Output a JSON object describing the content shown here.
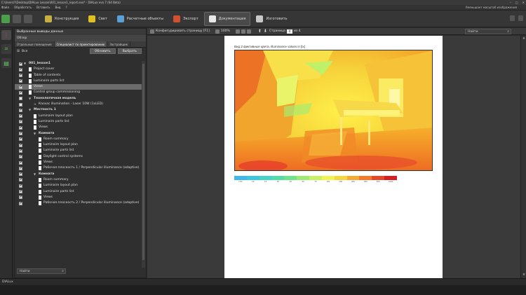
{
  "window": {
    "title": "C:\\Users\\?\\Desktop\\DIALux Lesson\\001_lesson1_report.evo* - DIALux evo 7 (64 Beta)",
    "menu": [
      "Файл",
      "Обработать",
      "Вставить",
      "Вид",
      "?"
    ],
    "menu_hint": "Уменьшает масштаб изображения"
  },
  "toolbar": {
    "tabs": [
      {
        "label": "Конструкция",
        "color": "#c8b040"
      },
      {
        "label": "Свет",
        "color": "#e0c020"
      },
      {
        "label": "Расчетные объекты",
        "color": "#5aa0d8"
      },
      {
        "label": "Экспорт",
        "color": "#d05030"
      },
      {
        "label": "Документация",
        "color": "#e8e8e8"
      },
      {
        "label": "Изготовить",
        "color": "#c8c8c8"
      }
    ],
    "active_tab": "Документация"
  },
  "left_panel": {
    "header": "Выбранные выводы данных",
    "sub": "Обзор",
    "tabs": [
      "Отдельные помещения",
      "Специалист по проектированию",
      "Застройщик"
    ],
    "active_tab": "Специалист по проектированию",
    "all_label": "Все",
    "button_refresh": "Обновить",
    "button_select": "Выбрать",
    "search_value": "Найти",
    "tree": [
      {
        "label": "001_lesson1",
        "level": 0,
        "bold": true,
        "expand": true,
        "checked": true
      },
      {
        "label": "Project cover",
        "level": 1,
        "checked": true
      },
      {
        "label": "Table of contents",
        "level": 1,
        "checked": true
      },
      {
        "label": "Luminaire parts list",
        "level": 1,
        "checked": true
      },
      {
        "label": "Views",
        "level": 1,
        "checked": true,
        "selected": true
      },
      {
        "label": "Control group commissioning",
        "level": 1,
        "checked": true
      },
      {
        "label": "Технологичная модель",
        "level": 1,
        "bold": true,
        "expand": true,
        "checked": false
      },
      {
        "label": "Каскас illumination - Laser 10W (1xLED)",
        "level": 2,
        "checked": false,
        "arrow": true
      },
      {
        "label": "Местность 1",
        "level": 1,
        "bold": true,
        "expand": true,
        "checked": true
      },
      {
        "label": "Luminaire layout plan",
        "level": 2,
        "checked": true
      },
      {
        "label": "Luminaire parts list",
        "level": 2,
        "checked": true
      },
      {
        "label": "Views",
        "level": 2,
        "checked": true
      },
      {
        "label": "Комната",
        "level": 2,
        "bold": true,
        "expand": true,
        "checked": true
      },
      {
        "label": "Room summary",
        "level": 3,
        "checked": true
      },
      {
        "label": "Luminaire layout plan",
        "level": 3,
        "checked": true
      },
      {
        "label": "Luminaire parts list",
        "level": 3,
        "checked": true
      },
      {
        "label": "Daylight control systems",
        "level": 3,
        "checked": true
      },
      {
        "label": "Views",
        "level": 3,
        "checked": true
      },
      {
        "label": "Рабочая плоскость 1 / Perpendicular illuminance (adaptive)",
        "level": 3,
        "checked": true
      },
      {
        "label": "Комната",
        "level": 2,
        "bold": true,
        "expand": true,
        "checked": true
      },
      {
        "label": "Room summary",
        "level": 3,
        "checked": true
      },
      {
        "label": "Luminaire layout plan",
        "level": 3,
        "checked": true
      },
      {
        "label": "Luminaire parts list",
        "level": 3,
        "checked": true
      },
      {
        "label": "Views",
        "level": 3,
        "checked": true
      },
      {
        "label": "Рабочая плоскость 2 / Perpendicular illuminance (adaptive)",
        "level": 3,
        "checked": true
      }
    ]
  },
  "doc_toolbar": {
    "configure": "Конфигурировать страницу [F1]",
    "zoom": "100%",
    "page_label": "Страница",
    "page_current": "4",
    "page_total": "из 4",
    "search": "Найти"
  },
  "page": {
    "caption": "Вид 2 фиктивные цвета, Illuminance values in [lx]",
    "legend_colors": [
      "#3fb7ec",
      "#3cc8e0",
      "#46d4c6",
      "#54dca6",
      "#6fe38b",
      "#9deb72",
      "#c8f060",
      "#f1f34e",
      "#f7d53c",
      "#f7a933",
      "#f47a2a",
      "#e8472a",
      "#d71f1f"
    ],
    "legend_labels": [
      "7.81",
      "10",
      "15",
      "20",
      "30",
      "50",
      "75",
      "100",
      "150",
      "200",
      "300",
      "500",
      "1000"
    ]
  },
  "status": {
    "text": "DIALux"
  }
}
